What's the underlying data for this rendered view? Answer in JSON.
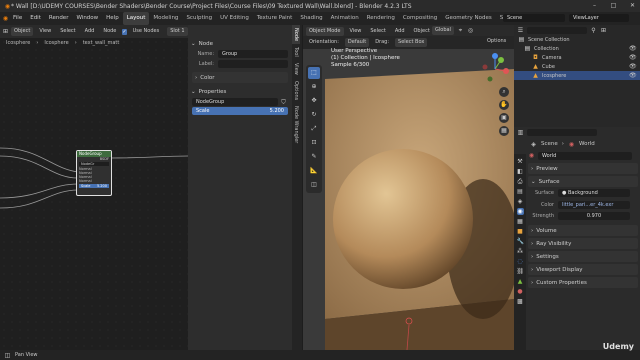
{
  "title": "* Wall [D:\\UDEMY COURSES\\Bender Shaders\\Bender Course\\Project Files\\Course Files\\09 Textured Wall\\Wall.blend] - Blender 4.2.3 LTS",
  "menu": [
    "File",
    "Edit",
    "Render",
    "Window",
    "Help"
  ],
  "workspaces": [
    "Layout",
    "Modeling",
    "Sculpting",
    "UV Editing",
    "Texture Paint",
    "Shading",
    "Animation",
    "Rendering",
    "Compositing",
    "Geometry Nodes",
    "Scripting"
  ],
  "active_workspace": "Layout",
  "scene_field": "Scene",
  "viewlayer_field": "ViewLayer",
  "node_editor": {
    "header": {
      "type": "Object",
      "menus": [
        "View",
        "Select",
        "Add",
        "Node"
      ],
      "use_nodes": "Use Nodes",
      "slot": "Slot 1",
      "material": "text_wall_matt"
    },
    "breadcrumb": [
      "Icosphere",
      "Icosphere",
      "text_wall_matt"
    ],
    "node": {
      "title": "NodeGroup",
      "output": "BSDF",
      "group": "NodeGr",
      "sockets": [
        "Normal",
        "Normal",
        "Normal",
        "Normal"
      ],
      "scale_label": "Scale",
      "scale_value": "5.200"
    }
  },
  "npanel": {
    "node_section": "Node",
    "name_label": "Name:",
    "name_value": "Group",
    "label_label": "Label:",
    "color_section": "Color",
    "properties_section": "Properties",
    "group_value": "NodeGroup",
    "scale_label": "Scale",
    "scale_value": "5.200",
    "tabs": [
      "Node",
      "Tool",
      "View",
      "Options",
      "Node Wrangler"
    ]
  },
  "viewport": {
    "mode": "Object Mode",
    "menus": [
      "View",
      "Select",
      "Add",
      "Object"
    ],
    "orientation_label": "Orientation:",
    "orientation": "Default",
    "drag_label": "Drag:",
    "select_box": "Select Box",
    "global": "Global",
    "options": "Options",
    "overlay_lines": [
      "User Perspective",
      "(1) Collection | Icosphere",
      "Sample 6/300"
    ],
    "gizmo": [
      "X",
      "Y",
      "Z"
    ]
  },
  "outliner": {
    "search_placeholder": "",
    "items": [
      {
        "name": "Scene Collection",
        "indent": 0,
        "icon": "collection-icon"
      },
      {
        "name": "Collection",
        "indent": 1,
        "icon": "collection-icon"
      },
      {
        "name": "Camera",
        "indent": 2,
        "icon": "camera-icon"
      },
      {
        "name": "Cube",
        "indent": 2,
        "icon": "mesh-icon"
      },
      {
        "name": "Icosphere",
        "indent": 2,
        "icon": "mesh-icon"
      }
    ]
  },
  "properties": {
    "breadcrumb": [
      "Scene",
      "World"
    ],
    "world_name": "World",
    "sections": [
      "Preview",
      "Surface"
    ],
    "surface_label": "Surface",
    "surface_value": "Background",
    "color_label": "Color",
    "color_value": "little_pari...er_4k.exr",
    "strength_label": "Strength",
    "strength_value": "0.970",
    "collapsed": [
      "Volume",
      "Ray Visibility",
      "Settings",
      "Viewport Display",
      "Custom Properties"
    ]
  },
  "status": {
    "pan_view": "Pan View",
    "watermark": "Udemy"
  },
  "colors": {
    "accent": "#4772b3",
    "orange": "#e8a33d",
    "wall": "#b8956a"
  }
}
